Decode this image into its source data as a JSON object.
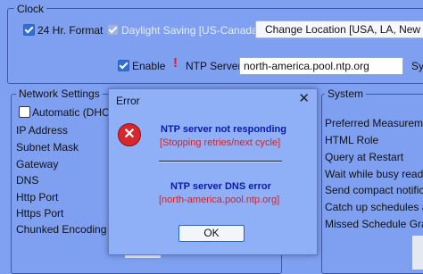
{
  "clock": {
    "legend": "Clock",
    "hr24_label": "24 Hr. Format",
    "dst_label": "Daylight Saving [US-Canada]",
    "change_location_label": "Change Location [USA, LA, New Orl",
    "enable_label": "Enable",
    "ntp_warning": "!",
    "ntp_server_label": "NTP Server",
    "ntp_server_value": "north-america.pool.ntp.org",
    "sync_label_partial": "Sy"
  },
  "network": {
    "legend": "Network Settings",
    "automatic_label": "Automatic (DHCP",
    "items": [
      "IP Address",
      "Subnet Mask",
      "Gateway",
      "DNS",
      "Http Port",
      "Https Port",
      "Chunked Encoding"
    ]
  },
  "system": {
    "legend": "System",
    "items": [
      "Preferred Measurement",
      "HTML Role",
      "Query at Restart",
      "Wait while busy readin",
      "Send compact notificat",
      "Catch up schedules aft",
      "Missed Schedule Grac"
    ]
  },
  "dialog": {
    "title": "Error",
    "close_glyph": "✕",
    "error_glyph": "✕",
    "msg1_title": "NTP server not responding",
    "msg1_sub": "[Stopping retries/next cycle]",
    "msg2_title": "NTP server DNS error",
    "msg2_sub": "[north-america.pool.ntp.org]",
    "ok_label": "OK"
  },
  "colors": {
    "background": "#7f9ff0",
    "dialog_bg": "#8fb0f7",
    "title_text": "#0c1aa8",
    "error_text": "#e21b1b",
    "error_icon": "#d8262b"
  }
}
